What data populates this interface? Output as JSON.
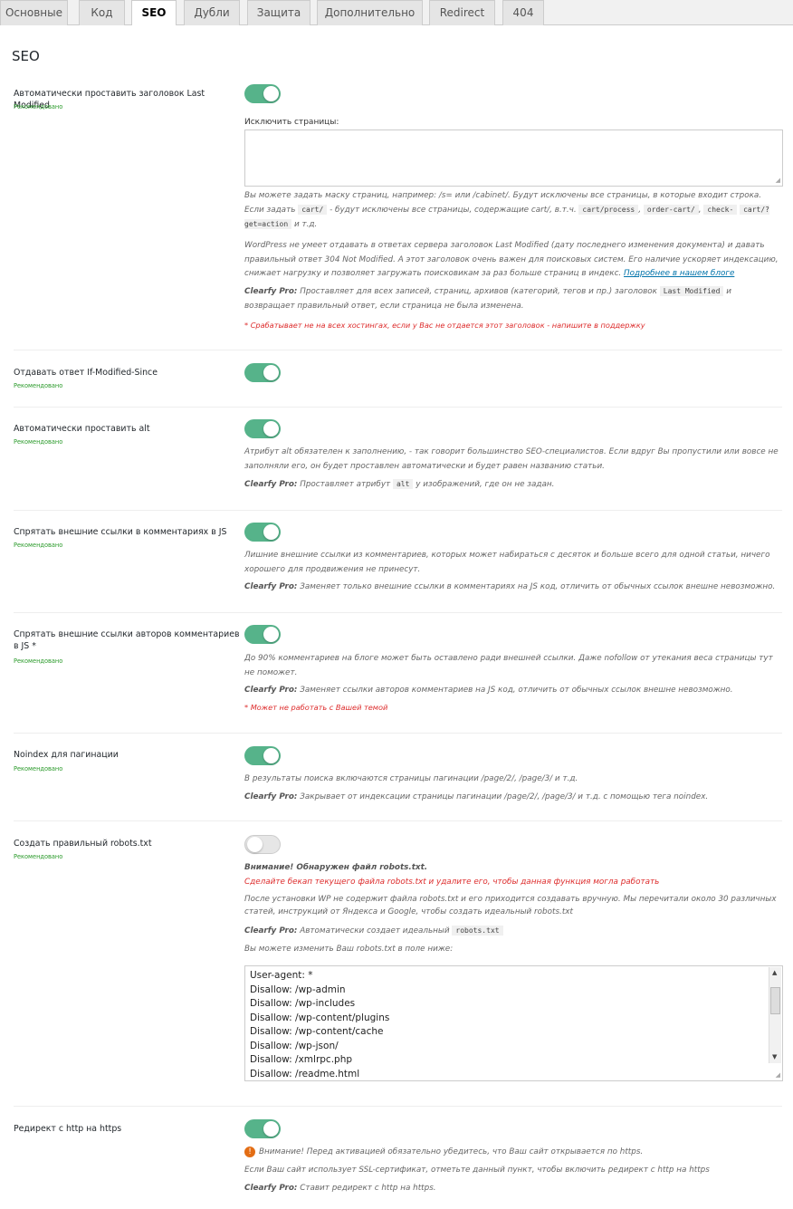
{
  "tabs": [
    {
      "label": "Основные"
    },
    {
      "label": "Код"
    },
    {
      "label": "SEO"
    },
    {
      "label": "Дубли"
    },
    {
      "label": "Защита"
    },
    {
      "label": "Дополнительно"
    },
    {
      "label": "Redirect"
    },
    {
      "label": "404"
    }
  ],
  "page_title": "SEO",
  "recommended": "Рекомендовано",
  "clearfy_pro": "Clearfy Pro:",
  "options": {
    "last_modified": {
      "label": "Автоматически проставить заголовок Last Modified",
      "enabled": true,
      "exclude_label": "Исключить страницы:",
      "exclude_value": "",
      "desc1_a": "Вы можете задать маску страниц, например: /s= или /cabinet/. Будут исключены все страницы, в которые входит строка.",
      "desc1_b": "Если задать",
      "code_cart": "cart/",
      "desc1_c": "- будут исключены все страницы, содержащие cart/, в.т.ч.",
      "code_cart_process": "cart/process",
      "code_order_cart": "order-cart/",
      "code_check_cart": "check-",
      "code_check_cart2": "cart/?get=action",
      "desc1_d": "и т.д.",
      "desc2": "WordPress не умеет отдавать в ответах сервера заголовок Last Modified (дату последнего изменения документа) и давать правильный ответ 304 Not Modified. А этот заголовок очень важен для поисковых систем. Его наличие ускоряет индексацию, снижает нагрузку и позволяет загружать поисковикам за раз больше страниц в индекс.",
      "desc2_link": "Подробнее в нашем блоге",
      "pro_a": "Проставляет для всех записей, страниц, архивов (категорий, тегов и пр.) заголовок",
      "code_last_modified": "Last Modified",
      "pro_b": "и возвращает правильный ответ, если страница не была изменена.",
      "warning": "* Срабатывает не на всех хостингах, если у Вас не отдается этот заголовок - напишите в поддержку"
    },
    "if_modified": {
      "label": "Отдавать ответ If-Modified-Since",
      "enabled": true
    },
    "auto_alt": {
      "label": "Автоматически проставить alt",
      "enabled": true,
      "desc": "Атрибут alt обязателен к заполнению, - так говорит большинство SEO-специалистов. Если вдруг Вы пропустили или вовсе не заполняли его, он будет проставлен автоматически и будет равен названию статьи.",
      "pro_a": "Проставляет атрибут",
      "code_alt": "alt",
      "pro_b": "у изображений, где он не задан."
    },
    "hide_comment_links": {
      "label": "Спрятать внешние ссылки в комментариях в JS",
      "enabled": true,
      "desc": "Лишние внешние ссылки из комментариев, которых может набираться с десяток и больше всего для одной статьи, ничего хорошего для продвижения не принесут.",
      "pro": "Заменяет только внешние ссылки в комментариях на JS код, отличить от обычных ссылок внешне невозможно."
    },
    "hide_author_links": {
      "label": "Спрятать внешние ссылки авторов комментариев в JS *",
      "enabled": true,
      "desc": "До 90% комментариев на блоге может быть оставлено ради внешней ссылки. Даже nofollow от утекания веса страницы тут не поможет.",
      "pro": "Заменяет ссылки авторов комментариев на JS код, отличить от обычных ссылок внешне невозможно.",
      "warning": "* Может не работать с Вашей темой"
    },
    "noindex_pagination": {
      "label": "Noindex для пагинации",
      "enabled": true,
      "desc": "В результаты поиска включаются страницы пагинации /page/2/, /page/3/ и т.д.",
      "pro": "Закрывает от индексации страницы пагинации /page/2/, /page/3/ и т.д. с помощью тега noindex."
    },
    "robots": {
      "label": "Создать правильный robots.txt",
      "enabled": false,
      "alert_title": "Внимание! Обнаружен файл robots.txt.",
      "alert_text": "Сделайте бекап текущего файла robots.txt и удалите его, чтобы данная функция могла работать",
      "desc": "После установки WP не содержит файла robots.txt и его приходится создавать вручную. Мы перечитали около 30 различных статей, инструкций от Яндекса и Google, чтобы создать идеальный robots.txt",
      "pro_a": "Автоматически создает идеальный",
      "code_robots": "robots.txt",
      "edit_hint": "Вы можете изменить Ваш robots.txt в поле ниже:",
      "lines": [
        "User-agent: *",
        "Disallow: /wp-admin",
        "Disallow: /wp-includes",
        "Disallow: /wp-content/plugins",
        "Disallow: /wp-content/cache",
        "Disallow: /wp-json/",
        "Disallow: /xmlrpc.php",
        "Disallow: /readme.html"
      ]
    },
    "https_redirect": {
      "label": "Редирект с http на https",
      "enabled": true,
      "alert": "Внимание! Перед активацией обязательно убедитесь, что Ваш сайт открывается по https.",
      "desc": "Если Ваш сайт использует SSL-сертификат, отметьте данный пункт, чтобы включить редирект с http на https",
      "pro": "Ставит редирект с http на https."
    }
  },
  "colors": {
    "toggle_on": "#56b38a",
    "recommended": "#2a9a2a",
    "warning": "#dd2c2c",
    "link": "#0073aa"
  }
}
